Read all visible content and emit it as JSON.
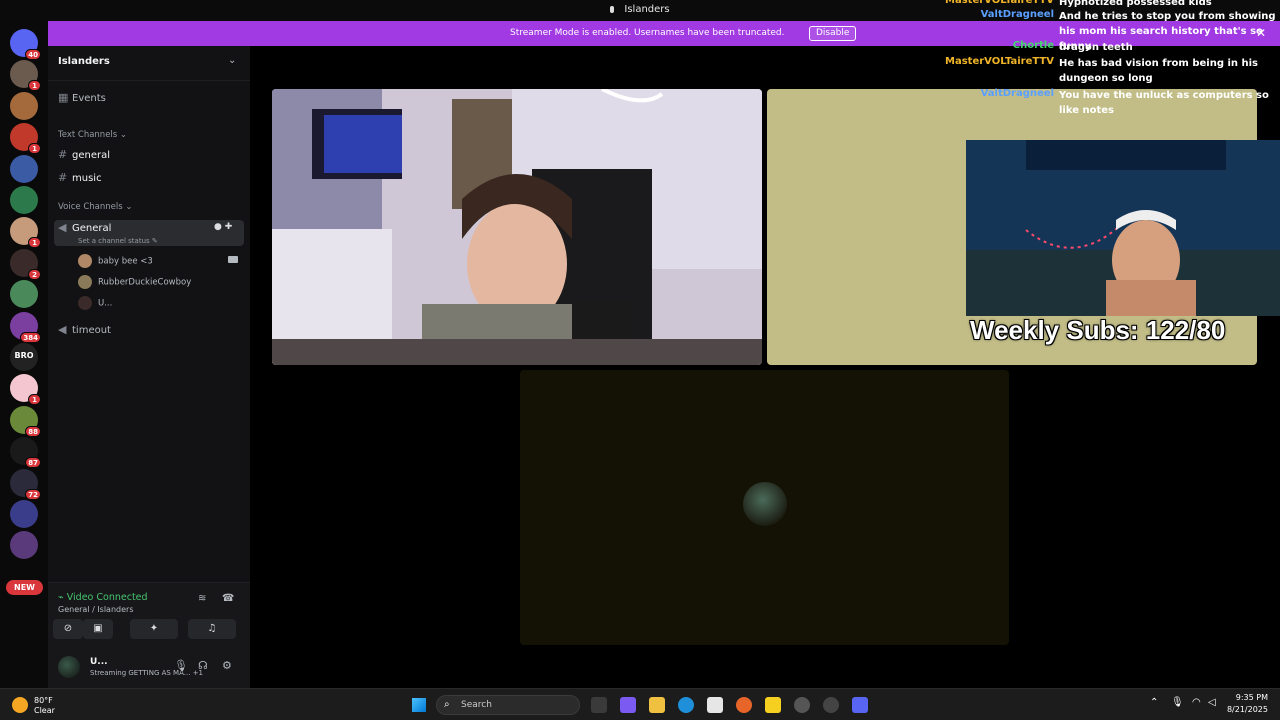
{
  "window": {
    "title": "Islanders"
  },
  "banner": {
    "text": "Streamer Mode is enabled. Usernames have been truncated.",
    "button": "Disable",
    "close": "✕"
  },
  "servers": [
    {
      "badge": "40",
      "color": "#5865f2"
    },
    {
      "badge": "1",
      "color": "#6b5a4e"
    },
    {
      "badge": "",
      "color": "#a46a3b"
    },
    {
      "badge": "1",
      "color": "#c0392b"
    },
    {
      "badge": "",
      "color": "#3b5ba5"
    },
    {
      "badge": "",
      "color": "#2c7a4b"
    },
    {
      "badge": "1",
      "color": "#c69b7b"
    },
    {
      "badge": "2",
      "color": "#3a2a2a"
    },
    {
      "badge": "",
      "color": "#4a8a5a"
    },
    {
      "badge": "384",
      "color": "#7b3fa0"
    },
    {
      "badge": "",
      "color": "#222222",
      "label": "BRO"
    },
    {
      "badge": "1",
      "color": "#f4c6d0"
    },
    {
      "badge": "88",
      "color": "#6a8a3a"
    },
    {
      "badge": "87",
      "color": "#1a1a1a"
    },
    {
      "badge": "72",
      "color": "#2a2a3a"
    },
    {
      "badge": "",
      "color": "#3a3d8a"
    },
    {
      "badge": "",
      "color": "#5a3a7a"
    }
  ],
  "new_pill": "NEW",
  "sidebar": {
    "server_name": "Islanders",
    "events": "Events",
    "text_category": "Text Channels",
    "text_channels": [
      "general",
      "music"
    ],
    "voice_category": "Voice Channels",
    "voice_channel": "General",
    "channel_status": "Set a channel status",
    "members": [
      {
        "name": "baby bee <3",
        "color": "#b08868"
      },
      {
        "name": "RubberDuckieCowboy",
        "color": "#8a7a5a"
      },
      {
        "name": "U...",
        "color": "#3a2a2a"
      }
    ],
    "timeout": "timeout"
  },
  "voice": {
    "status": "Video Connected",
    "location": "General / Islanders"
  },
  "user": {
    "name": "U...",
    "status": "Streaming GETTING AS MA...",
    "extra": "+1"
  },
  "chat": [
    {
      "user": "MasterVOLTaireTTV",
      "text": "Hypnotized possessed kids",
      "color": "#f0b429"
    },
    {
      "user": "ValtDragneel",
      "text": "And he tries to stop you from showing his mom his search history that's so funny",
      "color": "#5aa0ff"
    },
    {
      "user": "Chortle",
      "text": "dragon teeth",
      "color": "#45d46e"
    },
    {
      "user": "MasterVOLTaireTTV",
      "text": "He has bad vision from being in his dungeon so long",
      "color": "#f0b429"
    },
    {
      "user": "ValtDragneel",
      "text": "You have the unluck as computers so like notes",
      "color": "#5aa0ff"
    }
  ],
  "overlay": {
    "weekly_subs": "Weekly Subs: 122/80"
  },
  "taskbar": {
    "temp": "80°F",
    "condition": "Clear",
    "search": "Search",
    "time": "9:35 PM",
    "date": "8/21/2025"
  }
}
